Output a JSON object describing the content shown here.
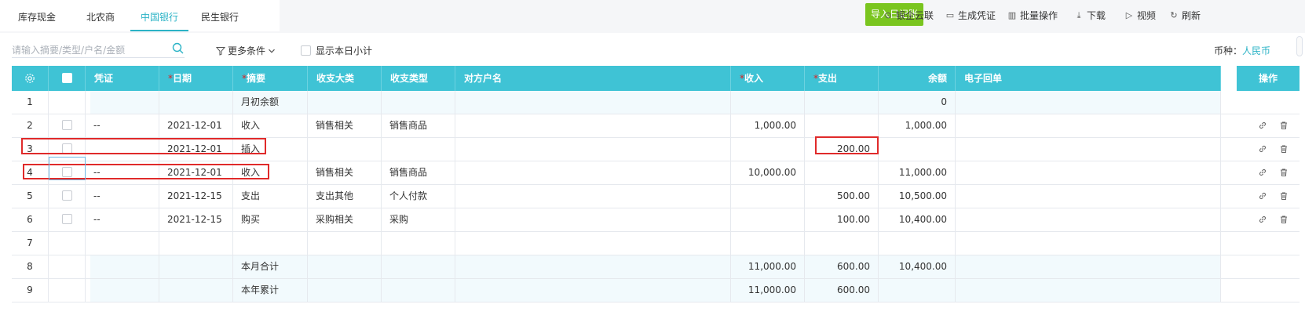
{
  "tabs": [
    {
      "label": "库存现金",
      "active": false
    },
    {
      "label": "北农商",
      "active": false
    },
    {
      "label": "中国银行",
      "active": true
    },
    {
      "label": "民生银行",
      "active": false
    }
  ],
  "toolbar": {
    "import_label": "导入日记账",
    "bank_cloud_label": "银企云联",
    "gen_voucher_label": "生成凭证",
    "batch_label": "批量操作",
    "download_label": "下载",
    "video_label": "视频",
    "refresh_label": "刷新"
  },
  "filter": {
    "search_placeholder": "请输入摘要/类型/户名/金额",
    "more_label": "更多条件",
    "show_daily_subtotal_label": "显示本日小计",
    "currency_label": "币种：",
    "currency_value": "人民币"
  },
  "table": {
    "headers": {
      "voucher": "凭证",
      "date": "日期",
      "summary": "摘要",
      "category": "收支大类",
      "type": "收支类型",
      "counterparty": "对方户名",
      "income": "收入",
      "expense": "支出",
      "balance": "余额",
      "receipt": "电子回单",
      "ops": "操作"
    },
    "rows": [
      {
        "no": "1",
        "voucher": "",
        "date": "",
        "summary": "月初余额",
        "category": "",
        "type": "",
        "counterparty": "",
        "income": "",
        "expense": "",
        "balance": "0",
        "receipt": "",
        "has_checkbox": false,
        "has_ops": false,
        "tint": true
      },
      {
        "no": "2",
        "voucher": "--",
        "date": "2021-12-01",
        "summary": "收入",
        "category": "销售相关",
        "type": "销售商品",
        "counterparty": "",
        "income": "1,000.00",
        "expense": "",
        "balance": "1,000.00",
        "receipt": "",
        "has_checkbox": true,
        "has_ops": true,
        "tint": false
      },
      {
        "no": "3",
        "voucher": "",
        "date": "2021-12-01",
        "summary": "插入",
        "category": "",
        "type": "",
        "counterparty": "",
        "income": "",
        "expense": "200.00",
        "balance": "",
        "receipt": "",
        "has_checkbox": true,
        "has_ops": true,
        "tint": false
      },
      {
        "no": "4",
        "voucher": "--",
        "date": "2021-12-01",
        "summary": "收入",
        "category": "销售相关",
        "type": "销售商品",
        "counterparty": "",
        "income": "10,000.00",
        "expense": "",
        "balance": "11,000.00",
        "receipt": "",
        "has_checkbox": true,
        "has_ops": true,
        "tint": false
      },
      {
        "no": "5",
        "voucher": "--",
        "date": "2021-12-15",
        "summary": "支出",
        "category": "支出其他",
        "type": "个人付款",
        "counterparty": "",
        "income": "",
        "expense": "500.00",
        "balance": "10,500.00",
        "receipt": "",
        "has_checkbox": true,
        "has_ops": true,
        "tint": false
      },
      {
        "no": "6",
        "voucher": "--",
        "date": "2021-12-15",
        "summary": "购买",
        "category": "采购相关",
        "type": "采购",
        "counterparty": "",
        "income": "",
        "expense": "100.00",
        "balance": "10,400.00",
        "receipt": "",
        "has_checkbox": true,
        "has_ops": true,
        "tint": false
      },
      {
        "no": "7",
        "voucher": "",
        "date": "",
        "summary": "",
        "category": "",
        "type": "",
        "counterparty": "",
        "income": "",
        "expense": "",
        "balance": "",
        "receipt": "",
        "has_checkbox": false,
        "has_ops": false,
        "tint": false
      },
      {
        "no": "8",
        "voucher": "",
        "date": "",
        "summary": "本月合计",
        "category": "",
        "type": "",
        "counterparty": "",
        "income": "11,000.00",
        "expense": "600.00",
        "balance": "10,400.00",
        "receipt": "",
        "has_checkbox": false,
        "has_ops": false,
        "tint": true
      },
      {
        "no": "9",
        "voucher": "",
        "date": "",
        "summary": "本年累计",
        "category": "",
        "type": "",
        "counterparty": "",
        "income": "11,000.00",
        "expense": "600.00",
        "balance": "",
        "receipt": "",
        "has_checkbox": false,
        "has_ops": false,
        "tint": true
      }
    ]
  },
  "icons": {
    "settings": "gear-icon",
    "link": "link-icon",
    "delete": "trash-icon"
  },
  "colors": {
    "header_bg": "#3fc3d5",
    "accent": "#2bb3c6",
    "import_button": "#7ac51f",
    "highlight_box": "#e02a2a"
  }
}
